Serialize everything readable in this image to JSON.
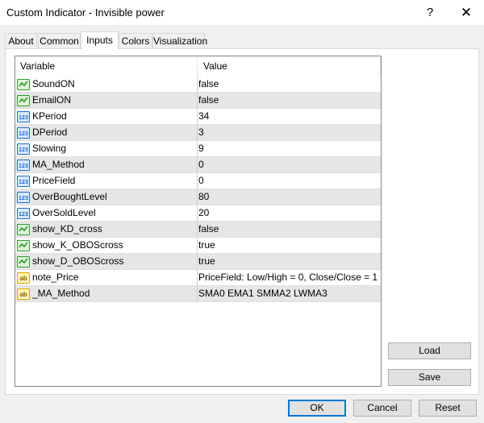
{
  "window": {
    "title": "Custom Indicator - Invisible power",
    "help_icon": "question-mark-icon",
    "close_icon": "close-icon"
  },
  "tabs": [
    {
      "label": "About"
    },
    {
      "label": "Common"
    },
    {
      "label": "Inputs",
      "active": true
    },
    {
      "label": "Colors"
    },
    {
      "label": "Visualization"
    }
  ],
  "grid": {
    "columns": [
      "Variable",
      "Value"
    ],
    "rows": [
      {
        "type": "bool",
        "icon": "bool-icon",
        "name": "SoundON",
        "value": "false"
      },
      {
        "type": "bool",
        "icon": "bool-icon",
        "name": "EmailON",
        "value": "false"
      },
      {
        "type": "int",
        "icon": "int-icon",
        "name": "KPeriod",
        "value": "34"
      },
      {
        "type": "int",
        "icon": "int-icon",
        "name": "DPeriod",
        "value": "3"
      },
      {
        "type": "int",
        "icon": "int-icon",
        "name": "Slowing",
        "value": "9"
      },
      {
        "type": "int",
        "icon": "int-icon",
        "name": "MA_Method",
        "value": "0"
      },
      {
        "type": "int",
        "icon": "int-icon",
        "name": "PriceField",
        "value": "0"
      },
      {
        "type": "int",
        "icon": "int-icon",
        "name": "OverBoughtLevel",
        "value": "80"
      },
      {
        "type": "int",
        "icon": "int-icon",
        "name": "OverSoldLevel",
        "value": "20"
      },
      {
        "type": "bool",
        "icon": "bool-icon",
        "name": "show_KD_cross",
        "value": "false"
      },
      {
        "type": "bool",
        "icon": "bool-icon",
        "name": "show_K_OBOScross",
        "value": "true"
      },
      {
        "type": "bool",
        "icon": "bool-icon",
        "name": "show_D_OBOScross",
        "value": "true"
      },
      {
        "type": "string",
        "icon": "string-icon",
        "name": "note_Price",
        "value": "PriceField:  Low/High = 0, Close/Close = 1"
      },
      {
        "type": "string",
        "icon": "string-icon",
        "name": "_MA_Method",
        "value": "SMA0 EMA1 SMMA2 LWMA3"
      }
    ]
  },
  "side_buttons": {
    "load": "Load",
    "save": "Save"
  },
  "footer": {
    "ok": "OK",
    "cancel": "Cancel",
    "reset": "Reset"
  },
  "colors": {
    "default_button_border": "#0078d7",
    "int_icon": "#1f6fc6",
    "bool_icon": "#2e9b2e",
    "string_icon": "#d9a400"
  }
}
